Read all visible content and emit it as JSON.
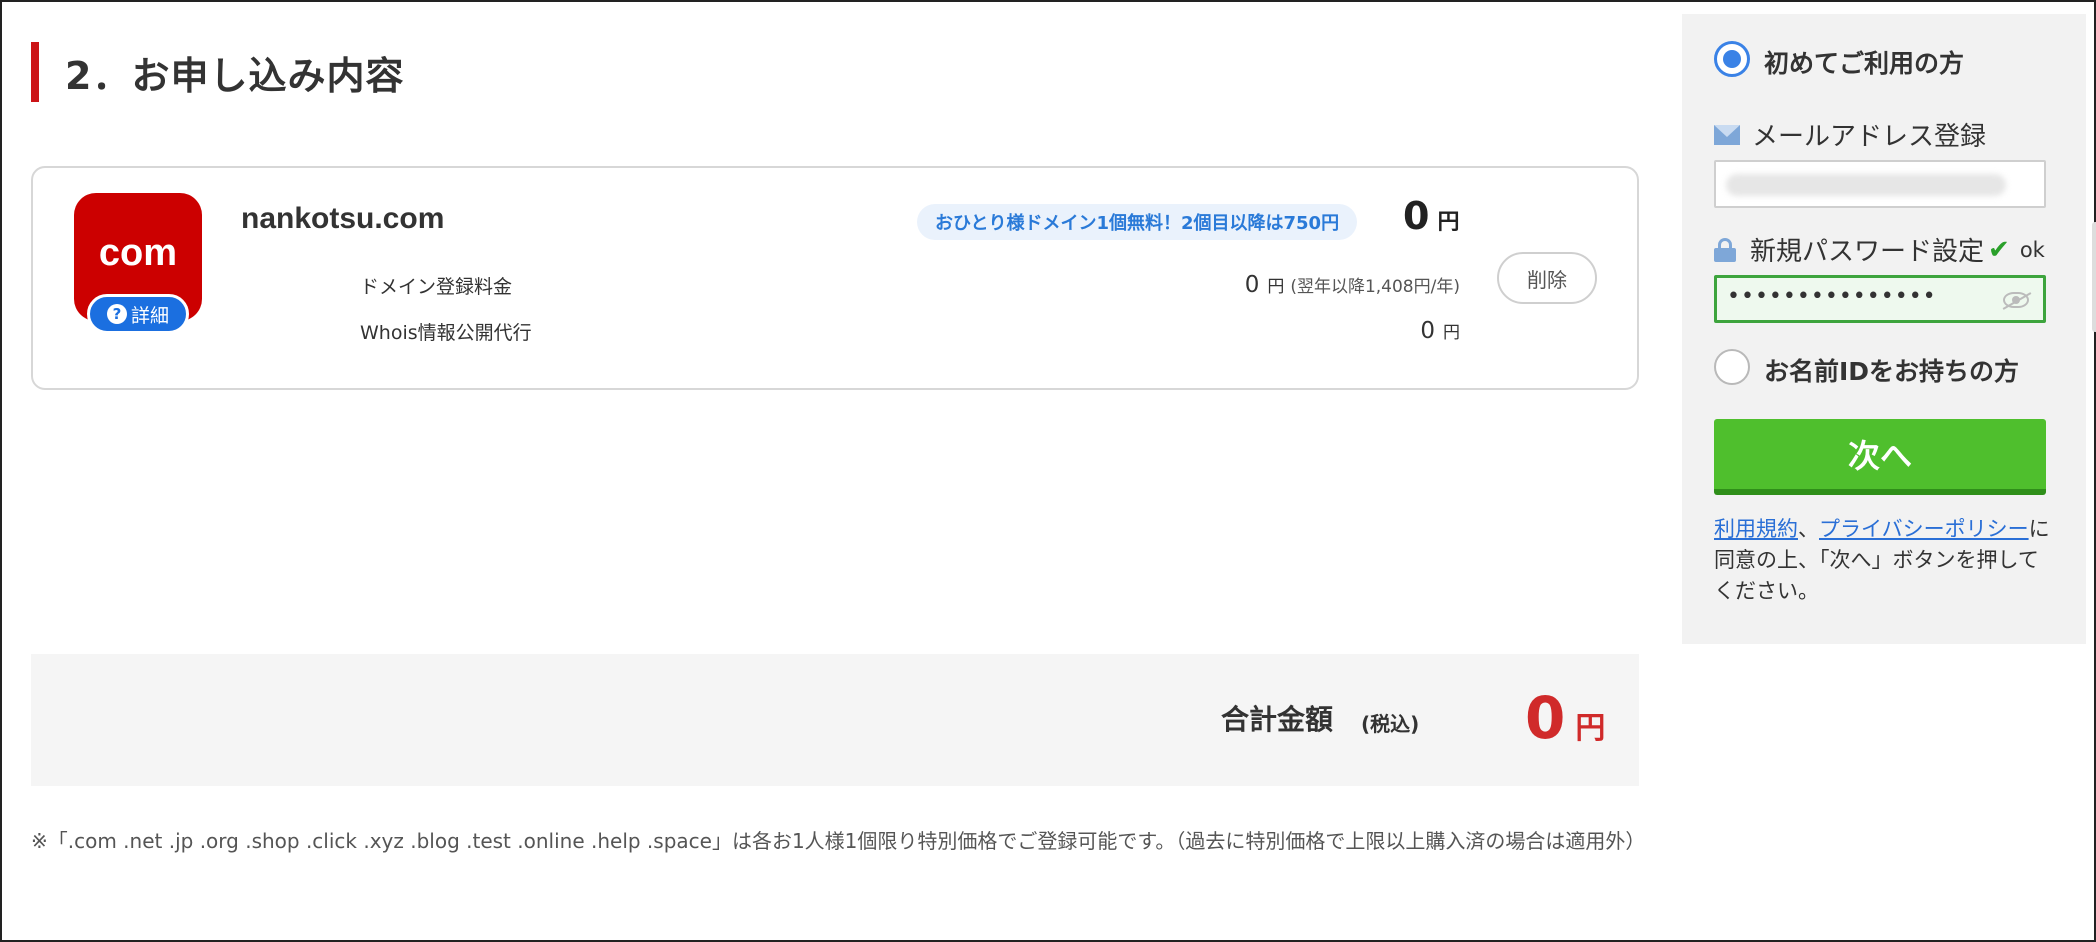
{
  "section": {
    "title": "2．お申し込み内容"
  },
  "domain_item": {
    "tld_label": "com",
    "detail_label": "詳細",
    "name": "nankotsu.com",
    "promo": "おひとり様ドメイン1個無料！2個目以降は750円",
    "price": "0",
    "price_unit": "円",
    "delete_label": "削除",
    "fees": [
      {
        "label": "ドメイン登録料金",
        "amount": "0",
        "unit": "円",
        "note": "(翌年以降1,408円/年)"
      },
      {
        "label": "Whois情報公開代行",
        "amount": "0",
        "unit": "円",
        "note": ""
      }
    ]
  },
  "total": {
    "label": "合計金額",
    "tax_note": "(税込)",
    "amount": "0",
    "unit": "円"
  },
  "footnote": "※「.com .net .jp .org .shop .click .xyz .blog .test .online .help .space」は各お1人様1個限り特別価格でご登録可能です。（過去に特別価格で上限以上購入済の場合は適用外）",
  "sidebar": {
    "new_user_label": "初めてご利用の方",
    "new_user_selected": true,
    "email_label": "メールアドレス登録",
    "email_value": "",
    "password_label": "新規パスワード設定",
    "password_status": "ok",
    "password_value": "•••••••••••••••",
    "existing_user_label": "お名前IDをお持ちの方",
    "existing_user_selected": false,
    "next_label": "次へ",
    "terms_link": "利用規約",
    "terms_sep": "、",
    "privacy_link": "プライバシーポリシー",
    "agreement_text": "に同意の上、「次へ」ボタンを押してください。"
  },
  "colors": {
    "accent_red": "#cc1417",
    "total_red": "#d02a2a",
    "next_green": "#4fbf2d",
    "radio_blue": "#3a82e6",
    "link_blue": "#2a6fd6"
  },
  "icons": [
    "mail-icon",
    "lock-icon",
    "check-icon",
    "eye-off-icon",
    "question-icon"
  ]
}
